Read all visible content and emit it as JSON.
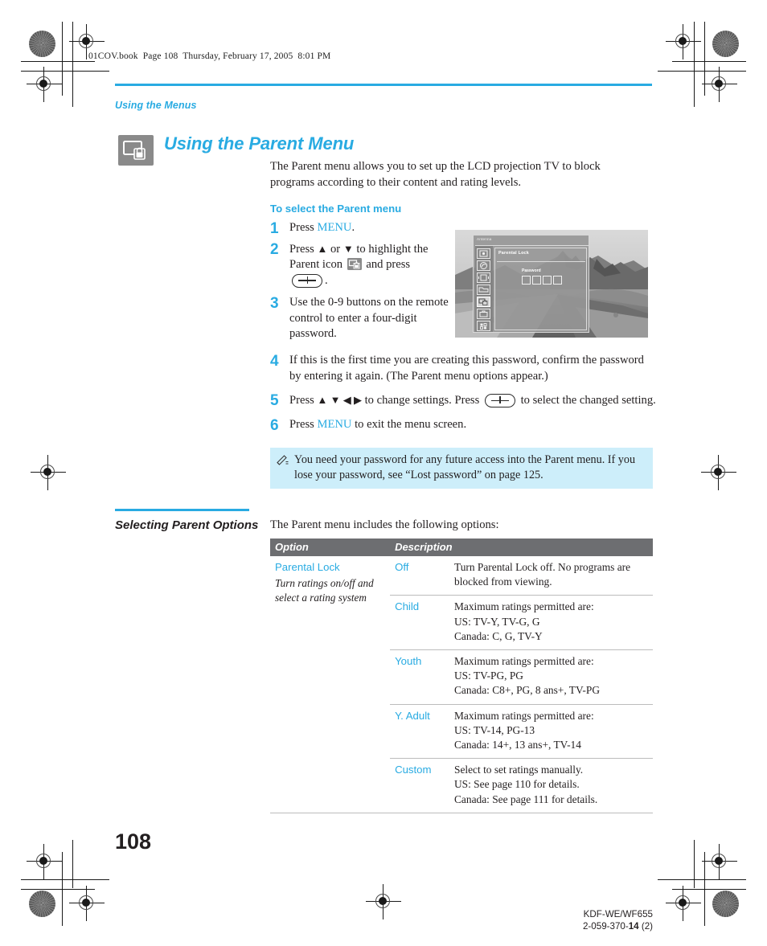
{
  "print_marks": {
    "book_line": "01COV.book  Page 108  Thursday, February 17, 2005  8:01 PM"
  },
  "accent_color": "#29abe2",
  "header": {
    "running_head": "Using the Menus",
    "chapter_title": "Using the Parent Menu",
    "chapter_icon": "tv-lock-icon"
  },
  "intro": {
    "paragraph": "The Parent menu allows you to set up the LCD projection TV to block programs according to their content and rating levels."
  },
  "procedure": {
    "subhead": "To select the Parent menu",
    "steps": [
      {
        "number": "1",
        "pre": "Press ",
        "keyword": "MENU",
        "post": "."
      },
      {
        "number": "2",
        "pre": "Press ",
        "arrows": "♦ or ♦",
        "mid": " to highlight the Parent icon ",
        "post": " and press",
        "tail": "."
      },
      {
        "number": "3",
        "text": "Use the 0-9 buttons on the remote control to enter a four-digit password."
      },
      {
        "number": "4",
        "text": "If this is the first time you are creating this password, confirm the password by entering it again. (The Parent menu options appear.)"
      },
      {
        "number": "5",
        "pre": "Press ",
        "arrows": "♦ ♦ ♦ ♦",
        "mid": " to change settings. Press ",
        "post": " to select the changed setting."
      },
      {
        "number": "6",
        "pre": "Press ",
        "keyword": "MENU",
        "post": " to exit the menu screen."
      }
    ]
  },
  "tv_screenshot": {
    "osd_title": "Antenna",
    "pane_title": "Parental Lock",
    "password_label": "Password",
    "password_boxes": 4,
    "sidebar_icons": [
      "picture-icon",
      "audio-icon",
      "screen-icon",
      "channel-icon",
      "parent-icon",
      "setup-icon",
      "apps-icon"
    ],
    "selected_icon_index": 4
  },
  "note": {
    "icon": "pencil-note-icon",
    "text": "You need your password for any future access into the Parent menu. If you lose your password, see “Lost password” on page 125."
  },
  "section": {
    "heading": "Selecting Parent Options",
    "lead_in": "The Parent menu includes the following options:"
  },
  "table": {
    "headers": {
      "option": "Option",
      "description": "Description"
    },
    "option_name": "Parental Lock",
    "option_subtitle": "Turn ratings on/off and select a rating system",
    "rows": [
      {
        "value": "Off",
        "lines": [
          "Turn Parental Lock off. No programs are",
          "blocked from viewing."
        ]
      },
      {
        "value": "Child",
        "lines": [
          "Maximum ratings permitted are:",
          "US: TV-Y, TV-G, G",
          "Canada: C, G, TV-Y"
        ]
      },
      {
        "value": "Youth",
        "lines": [
          "Maximum ratings permitted are:",
          "US: TV-PG, PG",
          "Canada: C8+, PG, 8 ans+, TV-PG"
        ]
      },
      {
        "value": "Y. Adult",
        "lines": [
          "Maximum ratings permitted are:",
          "US: TV-14, PG-13",
          "Canada: 14+, 13 ans+, TV-14"
        ]
      },
      {
        "value": "Custom",
        "lines": [
          "Select to set ratings manually.",
          "US: See page 110 for details.",
          "Canada: See page 111 for details."
        ]
      }
    ]
  },
  "footer": {
    "page_number": "108",
    "model": "KDF-WE/WF655",
    "doc_number_prefix": "2-059-370-",
    "doc_number_bold": "14",
    "doc_number_suffix": " (2)"
  }
}
